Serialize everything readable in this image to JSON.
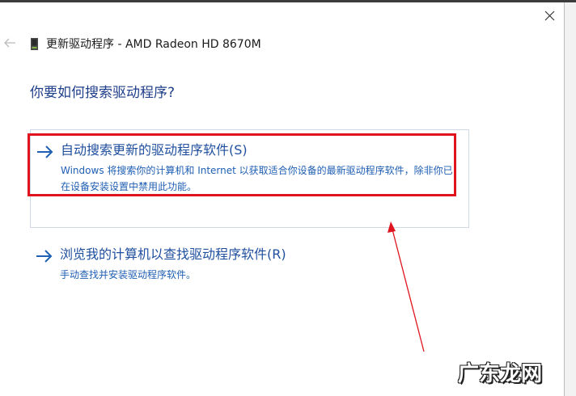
{
  "window": {
    "title": "更新驱动程序 - AMD Radeon HD 8670M",
    "close_icon": "close-icon",
    "back_icon": "back-arrow-icon",
    "device_icon": "graphics-card-icon"
  },
  "main": {
    "question": "你要如何搜索驱动程序?",
    "options": [
      {
        "title": "自动搜索更新的驱动程序软件(S)",
        "description": "Windows 将搜索你的计算机和 Internet 以获取适合你设备的最新驱动程序软件，除非你已在设备安装设置中禁用此功能。",
        "icon": "arrow-right-icon"
      },
      {
        "title": "浏览我的计算机以查找驱动程序软件(R)",
        "description": "手动查找并安装驱动程序软件。",
        "icon": "arrow-right-icon"
      }
    ]
  },
  "annotation": {
    "highlight_color": "#e0141e",
    "watermark": "广东龙网"
  },
  "colors": {
    "link_blue": "#1f4f9e",
    "question_blue": "#1f3f8a"
  }
}
